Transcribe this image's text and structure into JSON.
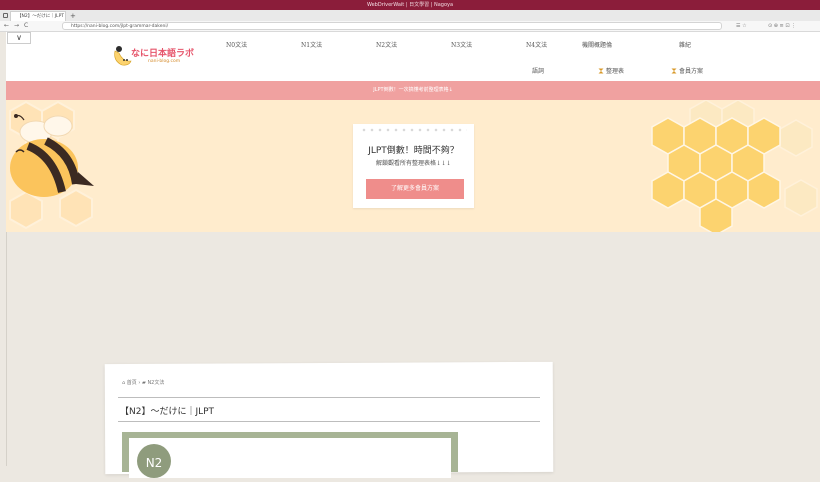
{
  "browser": {
    "system_title": "WebDriverWait | 日文學習 | Nagoya",
    "tab_label": "【N2】～だけに｜JLPT | ×",
    "new_tab": "+",
    "nav_back": "←",
    "nav_forward": "→",
    "nav_reload": "C",
    "url": "https://nani-blog.com/jlpt-grammar-dakeni/",
    "right_controls": [
      "☰ ☆",
      "⊙  ⊕  ≡  ⊡  ⋮"
    ]
  },
  "header": {
    "dropdown_icon": "chevron-down-icon",
    "dropdown_glyph": "∨",
    "logo_text": "なに日本語ラボ",
    "logo_url": "nani-blog.com",
    "menu_row1": [
      "N0文法",
      "N1文法",
      "N2文法",
      "N3文法",
      "N4文法",
      "機關概題倫",
      "雜紀"
    ],
    "menu_row2": [
      "語詞",
      "整理表",
      "會員方案"
    ]
  },
  "announcement": "JLPT倒數！一次搞懂考前整理表格↓",
  "hero": {
    "title": "JLPT倒數！時間不夠？",
    "subtitle": "解鎖觀看所有整理表格↓↓↓",
    "button": "了解更多會員方案"
  },
  "post": {
    "breadcrumb_home": "首頁",
    "breadcrumb_sep": "›",
    "breadcrumb_category": "N2文法",
    "title": "【N2】～だけに｜JLPT",
    "badge": "N2"
  },
  "colors": {
    "browser_bar": "#8b1d3a",
    "brand_pink": "#e6556b",
    "announcement": "#f0a1a0",
    "hero_bg": "#ffeccd",
    "cta": "#ef8d8b",
    "honey": "#fcd36f",
    "thumb_green": "#a7b495"
  }
}
